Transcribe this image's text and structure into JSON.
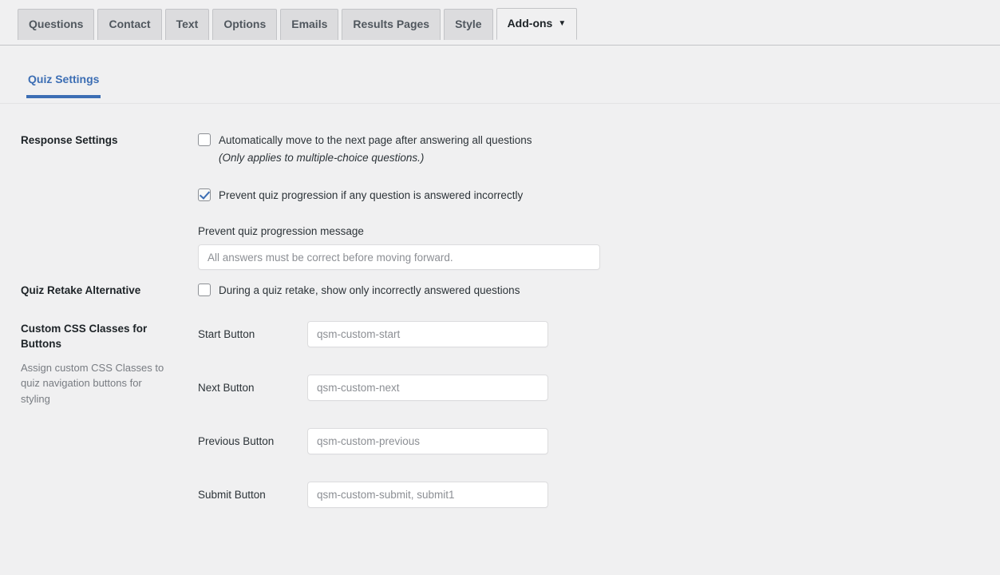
{
  "top_tabs": [
    {
      "label": "Questions",
      "active": false
    },
    {
      "label": "Contact",
      "active": false
    },
    {
      "label": "Text",
      "active": false
    },
    {
      "label": "Options",
      "active": false
    },
    {
      "label": "Emails",
      "active": false
    },
    {
      "label": "Results Pages",
      "active": false
    },
    {
      "label": "Style",
      "active": false
    },
    {
      "label": "Add-ons",
      "active": true,
      "caret": "▼"
    }
  ],
  "subtabs": [
    {
      "label": "Quiz Settings",
      "active": true
    }
  ],
  "sections": {
    "response_settings": {
      "label": "Response Settings",
      "auto_advance": {
        "checked": false,
        "label": "Automatically move to the next page after answering all questions",
        "note": "(Only applies to multiple-choice questions.)"
      },
      "prevent_progression": {
        "checked": true,
        "label": "Prevent quiz progression if any question is answered incorrectly"
      },
      "prevent_message": {
        "label": "Prevent quiz progression message",
        "value": "",
        "placeholder": "All answers must be correct before moving forward."
      }
    },
    "quiz_retake": {
      "label": "Quiz Retake Alternative",
      "retake_option": {
        "checked": false,
        "label": "During a quiz retake, show only incorrectly answered questions"
      }
    },
    "custom_css": {
      "label": "Custom CSS Classes for Buttons",
      "help": "Assign custom CSS Classes to quiz navigation buttons for styling",
      "fields": [
        {
          "label": "Start Button",
          "value": "",
          "placeholder": "qsm-custom-start"
        },
        {
          "label": "Next Button",
          "value": "",
          "placeholder": "qsm-custom-next"
        },
        {
          "label": "Previous Button",
          "value": "",
          "placeholder": "qsm-custom-previous"
        },
        {
          "label": "Submit Button",
          "value": "",
          "placeholder": "qsm-custom-submit, submit1"
        }
      ]
    }
  },
  "colors": {
    "accent": "#3c6eb4",
    "page_bg": "#f0f0f1",
    "tab_bg": "#dcdcde",
    "border": "#c3c4c7"
  }
}
